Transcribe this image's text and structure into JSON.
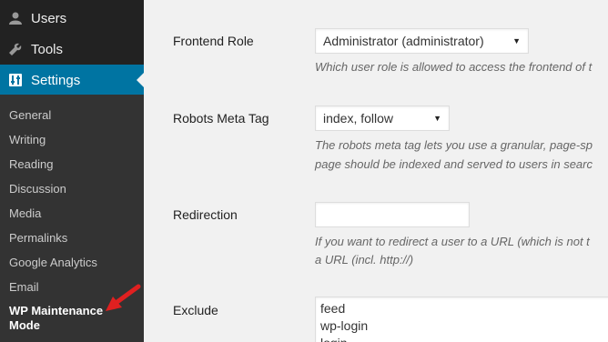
{
  "sidebar": {
    "top_items": [
      {
        "label": "Users",
        "icon": "user-icon"
      },
      {
        "label": "Tools",
        "icon": "wrench-icon"
      },
      {
        "label": "Settings",
        "icon": "settings-icon"
      }
    ],
    "submenu": [
      "General",
      "Writing",
      "Reading",
      "Discussion",
      "Media",
      "Permalinks",
      "Google Analytics",
      "Email"
    ],
    "current_line1": "WP Maintenance",
    "current_line2": "Mode",
    "colors": {
      "background": "#222222",
      "submenu_bg": "#333333",
      "active": "#0074a2",
      "annotation_arrow": "#e02020"
    }
  },
  "form": {
    "frontend_role": {
      "label": "Frontend Role",
      "value": "Administrator (administrator)",
      "description": "Which user role is allowed to access the frontend of t"
    },
    "robots": {
      "label": "Robots Meta Tag",
      "value": "index, follow",
      "description_line1": "The robots meta tag lets you use a granular, page-sp",
      "description_line2": "page should be indexed and served to users in searc"
    },
    "redirection": {
      "label": "Redirection",
      "value": "",
      "description_line1": "If you want to redirect a user to a URL (which is not t",
      "description_line2": "a URL (incl. http://)"
    },
    "exclude": {
      "label": "Exclude",
      "lines": [
        "feed",
        "wp-login",
        "login"
      ]
    }
  }
}
